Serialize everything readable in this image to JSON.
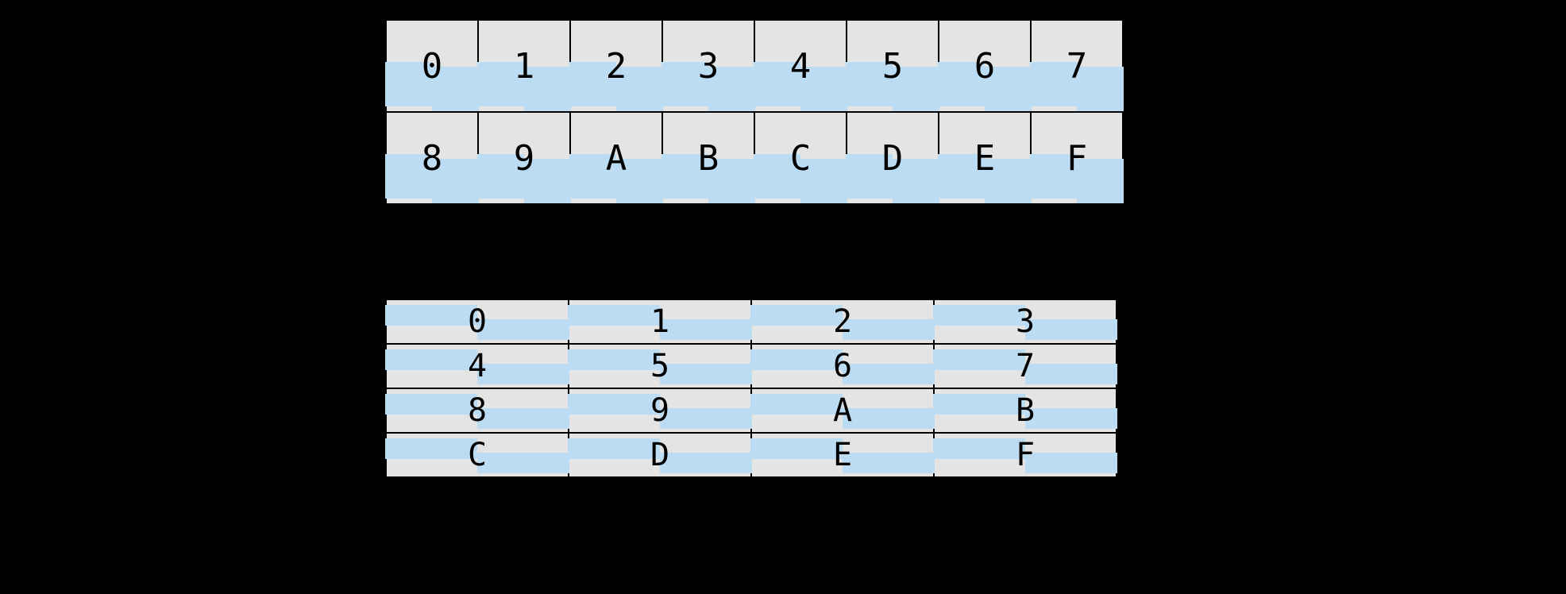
{
  "top_table": {
    "rows": [
      [
        "0",
        "1",
        "2",
        "3",
        "4",
        "5",
        "6",
        "7"
      ],
      [
        "8",
        "9",
        "A",
        "B",
        "C",
        "D",
        "E",
        "F"
      ]
    ]
  },
  "bottom_table": {
    "rows": [
      [
        "0",
        "1",
        "2",
        "3"
      ],
      [
        "4",
        "5",
        "6",
        "7"
      ],
      [
        "8",
        "9",
        "A",
        "B"
      ],
      [
        "C",
        "D",
        "E",
        "F"
      ]
    ]
  }
}
